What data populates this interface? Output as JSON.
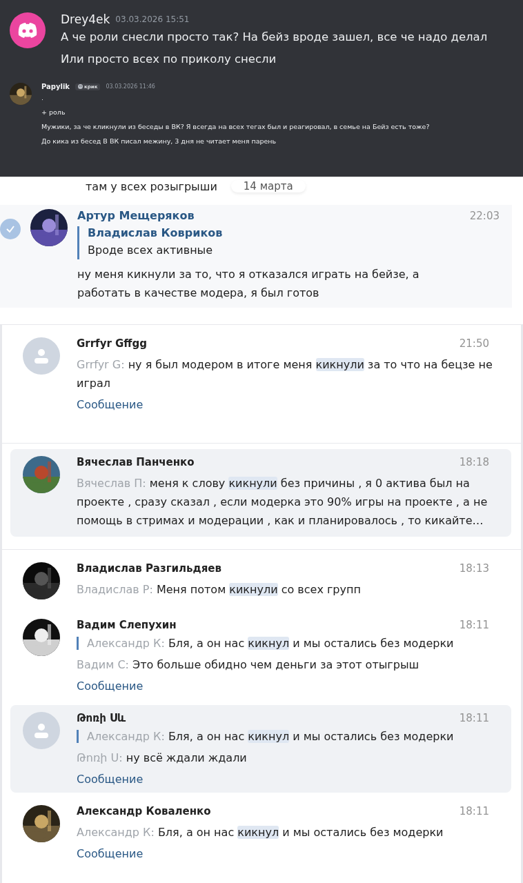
{
  "discord": {
    "messages": [
      {
        "kind": "large",
        "author": "Drey4ek",
        "time": "03.03.2026 15:51",
        "lines": [
          "А че роли снесли просто так? На бейз вроде зашел, все че надо делал",
          "Или просто всех по приколу снесли"
        ]
      },
      {
        "kind": "small",
        "author": "Papylik",
        "role": "крик",
        "time": "03.03.2026 11:46",
        "lines": [
          ".",
          "+ роль",
          "Мужики, за че кликнули из беседы в ВК? Я всегда на всех тегах был и реагировал, в семье на Бейз есть тоже?",
          "До кика из бесед В ВК писал межину, 3 дня не читает меня парень"
        ]
      }
    ]
  },
  "chat": {
    "previous_line": "там у всех розыгрыши",
    "date": "14 марта",
    "message": {
      "selected": true,
      "author": "Артур Мещеряков",
      "time": "22:03",
      "reply_author": "Владислав Ковриков",
      "reply_text": "Вроде всех активные",
      "text": "ну меня кикнули за то, что я отказался играть на бейзе, а работать в качестве модера, я был готов"
    }
  },
  "search_panels": [
    {
      "results": [
        {
          "selected": false,
          "has_photo": false,
          "name": "Grrfyr Gffgg",
          "time": "21:50",
          "prefix": "Grrfyr G:",
          "before": "ну я был модером в итоге меня ",
          "match": "кикнули",
          "after": " за то что на бецзе не играл",
          "link": "Сообщение"
        }
      ]
    },
    {
      "results": [
        {
          "selected": true,
          "has_photo": true,
          "name": "Вячеслав Панченко",
          "time": "18:18",
          "prefix": "Вячеслав П:",
          "before": "меня к слову ",
          "match": "кикнули",
          "after": " без причины , я 0 актива был на проекте , сразу сказал , если модерка это 90% игры на проекте , а не помощь в стримах и модерации , как и планировалось , то кикайте…"
        }
      ]
    },
    {
      "results": [
        {
          "selected": false,
          "has_photo": true,
          "name": "Владислав Разгильдяев",
          "time": "18:13",
          "prefix": "Владислав Р:",
          "before": "Меня потом ",
          "match": "кикнули",
          "after": " со всех групп"
        },
        {
          "selected": false,
          "has_photo": true,
          "name": "Вадим Слепухин",
          "time": "18:11",
          "quote": {
            "prefix": "Александр К:",
            "before": "Бля, а он нас ",
            "match": "кикнул",
            "after": " и мы остались без модерки"
          },
          "prefix": "Вадим С:",
          "before": "Это больше обидно чем деньги за этот отыгрыш",
          "link": "Сообщение"
        },
        {
          "selected": true,
          "has_photo": false,
          "name": "Թոռի Սև",
          "time": "18:11",
          "quote": {
            "prefix": "Александр К:",
            "before": "Бля, а он нас ",
            "match": "кикнул",
            "after": " и мы остались без модерки"
          },
          "prefix": "Թոռի Ս:",
          "before": "ну всё ждали ждали",
          "link": "Сообщение"
        },
        {
          "selected": false,
          "has_photo": true,
          "name": "Александр Коваленко",
          "time": "18:11",
          "prefix": "Александр К:",
          "before": "Бля, а он нас ",
          "match": "кикнул",
          "after": " и мы остались без модерки",
          "link": "Сообщение"
        }
      ]
    }
  ]
}
